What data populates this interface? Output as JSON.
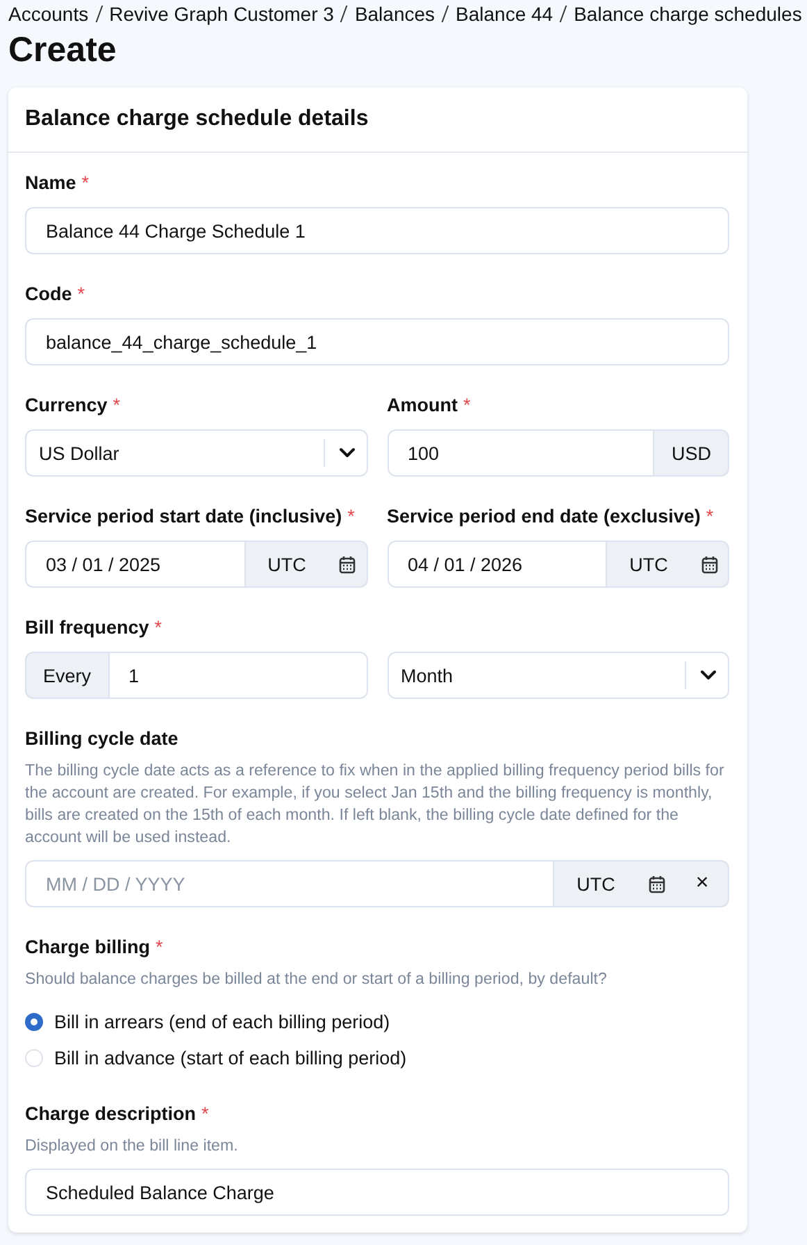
{
  "breadcrumb": [
    "Accounts",
    "Revive Graph Customer 3",
    "Balances",
    "Balance 44",
    "Balance charge schedules"
  ],
  "page_title": "Create",
  "card": {
    "title": "Balance charge schedule details",
    "rows": [
      [
        {
          "kind": "text",
          "label": "Name",
          "required_mark": "*",
          "value": "Balance 44 Charge Schedule 1"
        }
      ],
      [
        {
          "kind": "text",
          "label": "Code",
          "required_mark": "*",
          "value": "balance_44_charge_schedule_1"
        }
      ],
      [
        {
          "kind": "select",
          "label": "Currency",
          "required_mark": "*",
          "value": "US Dollar"
        },
        {
          "kind": "suffix",
          "label": "Amount",
          "required_mark": "*",
          "value": "100",
          "suffix": "USD"
        }
      ],
      [
        {
          "kind": "date",
          "label": "Service period start date (inclusive)",
          "required_mark": "*",
          "value": "03 / 01 / 2025",
          "timezone": "UTC"
        },
        {
          "kind": "date",
          "label": "Service period end date (exclusive)",
          "required_mark": "*",
          "value": "04 / 01 / 2026",
          "timezone": "UTC"
        }
      ],
      [
        {
          "kind": "prefix",
          "label": "Bill frequency",
          "required_mark": "*",
          "prefix": "Every",
          "value": "1"
        },
        {
          "kind": "select",
          "value": "Month"
        }
      ],
      [
        {
          "kind": "date",
          "label": "Billing cycle date",
          "help": "The billing cycle date acts as a reference to fix when in the applied billing frequency period bills for the account are created. For example, if you select Jan 15th and the billing frequency is monthly, bills are created on the 15th of each month. If left blank, the billing cycle date defined for the account will be used instead.",
          "placeholder": "MM / DD / YYYY",
          "timezone": "UTC",
          "clear": "×"
        }
      ],
      [
        {
          "kind": "radio",
          "label": "Charge billing",
          "required_mark": "*",
          "help": "Should balance charges be billed at the end or start of a billing period, by default?",
          "options": [
            {
              "label": "Bill in arrears (end of each billing period)",
              "selected": true
            },
            {
              "label": "Bill in advance (start of each billing period)",
              "selected": false
            }
          ]
        }
      ],
      [
        {
          "kind": "text",
          "label": "Charge description",
          "required_mark": "*",
          "help": "Displayed on the bill line item.",
          "value": "Scheduled Balance Charge"
        }
      ]
    ]
  }
}
